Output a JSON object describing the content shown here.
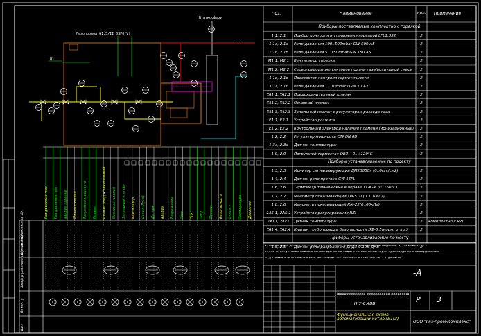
{
  "drawing": {
    "title_top_right": "-A",
    "stamp_block": "ООО \"Газ-пром-Комплекс\"",
    "sheet_prefix": "Р",
    "sheet_number": "3",
    "doc_title_line1": "Ӏрӧӧӧӧӧӧӧӧӧӧӧӧ ӧӧӧӧӧӧӧӧӧӧӧ ӧӧӧӧӧӧӧӧӧ",
    "doc_title_line2": "ТКУ-6.4ВВ",
    "func_scheme_title": "Функциональная схема автоматизации котла №1(3)",
    "chimney_label": "В атмосферу",
    "gas_label": "Газопровод G1.5/II DSP0(V)",
    "drainage_label": "Bl",
    "flow_label_tt": "TT"
  },
  "table": {
    "headers": {
      "pos": "Поз.",
      "name": "Наименование",
      "qty": "Кол.",
      "note": "Примечание"
    },
    "sections": [
      {
        "title": "Приборы поставляемые комплектно с горелкой"
      },
      {
        "title": "Приборы устанавливаемые по проекту"
      },
      {
        "title": "Приборы устанавливаемые по месту"
      }
    ],
    "rows": [
      {
        "pos": "1.1, 2.1",
        "name": "Прибор контроля и управления горелкой LFL1.332",
        "qty": "2",
        "note": ""
      },
      {
        "pos": "1.1а, 2.1а",
        "name": "Реле давления 100..500mbar GW 500 A5",
        "qty": "2",
        "note": ""
      },
      {
        "pos": "1.1б, 2.1б",
        "name": "Реле давления 5...150mbar GW 150 A5",
        "qty": "2",
        "note": ""
      },
      {
        "pos": "М1.1, М2.1",
        "name": "Вентилятор горелки",
        "qty": "2",
        "note": ""
      },
      {
        "pos": "М1.2, М2.2",
        "name": "Сервоприводы регуляторов подачи газа/воздушной смеси",
        "qty": "2",
        "note": ""
      },
      {
        "pos": "1.1в, 2.1в",
        "name": "Прессостат контроля герметичности",
        "qty": "2",
        "note": ""
      },
      {
        "pos": "1.1г, 2.1г",
        "name": "Реле давления 1...10mbar LGW 10 A2",
        "qty": "2",
        "note": ""
      },
      {
        "pos": "YA1.1, YA2.1",
        "name": "Предохранительный клапан",
        "qty": "2",
        "note": ""
      },
      {
        "pos": "YA1.2, YA2.2",
        "name": "Основной клапан",
        "qty": "2",
        "note": ""
      },
      {
        "pos": "YA1.3, YA2.3",
        "name": "Запальный клапан с регулятором расхода газа",
        "qty": "2",
        "note": ""
      },
      {
        "pos": "E1.1, E2.1",
        "name": "Устройство розжига",
        "qty": "2",
        "note": ""
      },
      {
        "pos": "E1.2, E2.2",
        "name": "Контрольный электрод наличия пламени (ионизационный)",
        "qty": "2",
        "note": ""
      },
      {
        "pos": "1.2, 2.2",
        "name": "Регулятор мощности CTRON 6B",
        "qty": "2",
        "note": ""
      },
      {
        "pos": "1.3а, 2.3а",
        "name": "Датчик температуры",
        "qty": "2",
        "note": ""
      },
      {
        "pos": "1.9, 2.9",
        "name": "Погружной термостат ОВЗ-+0..+120°С",
        "qty": "2",
        "note": ""
      },
      {
        "pos": "1.3, 2.3",
        "name": "Монитор сигнализирующий ДМ2005Сг (0..6кгс/см2)",
        "qty": "2",
        "note": ""
      },
      {
        "pos": "1.4, 2.4",
        "name": "Датчик-реле протока GW-16PL",
        "qty": "2",
        "note": ""
      },
      {
        "pos": "1.6, 2.6",
        "name": "Термометр технический в оправе ТТЖ-М (0..150°С)",
        "qty": "2",
        "note": ""
      },
      {
        "pos": "1.7, 2.7",
        "name": "Манометр показывающий ТМ-510 (0..0.6МПа)",
        "qty": "2",
        "note": ""
      },
      {
        "pos": "1.8, 2.8",
        "name": "Манометр показывающий КМ-22(0..60кПа)",
        "qty": "2",
        "note": ""
      },
      {
        "pos": "1А5.1, 2А5.1",
        "name": "Устройство регулирования RZI",
        "qty": "2",
        "note": ""
      },
      {
        "pos": "1КF1, 2КF1",
        "name": "Датчик температуры",
        "qty": "2",
        "note": "комплектно с RZI"
      },
      {
        "pos": "YA1.4, YA2.4",
        "name": "Клапан трубопровода безопасности ВФ-3.5(норм. откр.)",
        "qty": "2",
        "note": ""
      },
      {
        "pos": "1.5, 2.5",
        "name": "Датчик-реле разрежения ДРДЗ-0.125-ДНВ",
        "qty": "2",
        "note": ""
      }
    ],
    "notes": [
      "1. Схема дана для котла 1. Для котла 2 схема аналогична с заменой индекса \"1\" на индекс \"2\".",
      "2. Значения уставок подключаемых датчиков задать согласно паспорта производителя оборудования.",
      "3. Датчики и исполнительные механизмы поставляются комплектно с горелкой."
    ]
  },
  "column_labels": [
    "Газ давление max",
    "Газ давление min",
    "Авария горелки",
    "Пламя горелки",
    "Регулятор мощности",
    "Розжиг",
    "Клапан предохранительный",
    "Основной клапан",
    "Запальный клапан",
    "Вентилятор",
    "Котел (Пуск)",
    "Датчик",
    "Авария",
    "Разрежение",
    "Тгвс",
    "Тпк",
    "Тобр",
    "Проток",
    "Безопасность",
    "Котел 1",
    "Температура",
    "Давление"
  ],
  "left_rows": [
    "Щит автоматики котла ЩА",
    "Шкаф управления котельной ШК",
    "По месту",
    "Щит"
  ],
  "colors": {
    "background": "#000000",
    "frame": "#ffffff",
    "gas_line": "#ffff00",
    "flow_line": "#ff0000",
    "signal_line": "#00ff00",
    "cable": "#c0c0c0",
    "equipment": "#ff8000",
    "water": "#00ffff",
    "purple": "#ff00ff"
  }
}
